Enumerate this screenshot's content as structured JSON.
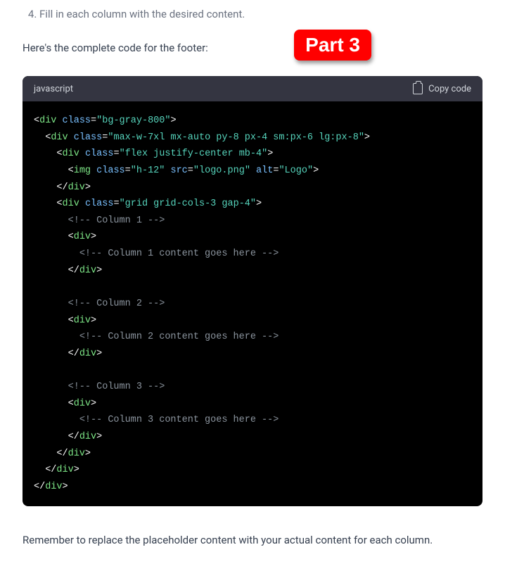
{
  "step": {
    "number": "4.",
    "text": "Fill in each column with the desired content."
  },
  "intro": "Here's the complete code for the footer:",
  "badge": "Part 3",
  "code_header": {
    "lang": "javascript",
    "copy_label": "Copy code"
  },
  "code": {
    "l01": {
      "t1": "div",
      "a1": "class",
      "v1": "\"bg-gray-800\""
    },
    "l02": {
      "t1": "div",
      "a1": "class",
      "v1": "\"max-w-7xl mx-auto py-8 px-4 sm:px-6 lg:px-8\""
    },
    "l03": {
      "t1": "div",
      "a1": "class",
      "v1": "\"flex justify-center mb-4\""
    },
    "l04": {
      "t1": "img",
      "a1": "class",
      "v1": "\"h-12\"",
      "a2": "src",
      "v2": "\"logo.png\"",
      "a3": "alt",
      "v3": "\"Logo\""
    },
    "l05": {
      "t1": "div"
    },
    "l06": {
      "t1": "div",
      "a1": "class",
      "v1": "\"grid grid-cols-3 gap-4\""
    },
    "c1": "<!-- Column 1 -->",
    "c1a": "<!-- Column 1 content goes here -->",
    "c2": "<!-- Column 2 -->",
    "c2a": "<!-- Column 2 content goes here -->",
    "c3": "<!-- Column 3 -->",
    "c3a": "<!-- Column 3 content goes here -->",
    "divopen": "div",
    "divclose": "div"
  },
  "closing": "Remember to replace the placeholder content with your actual content for each column."
}
